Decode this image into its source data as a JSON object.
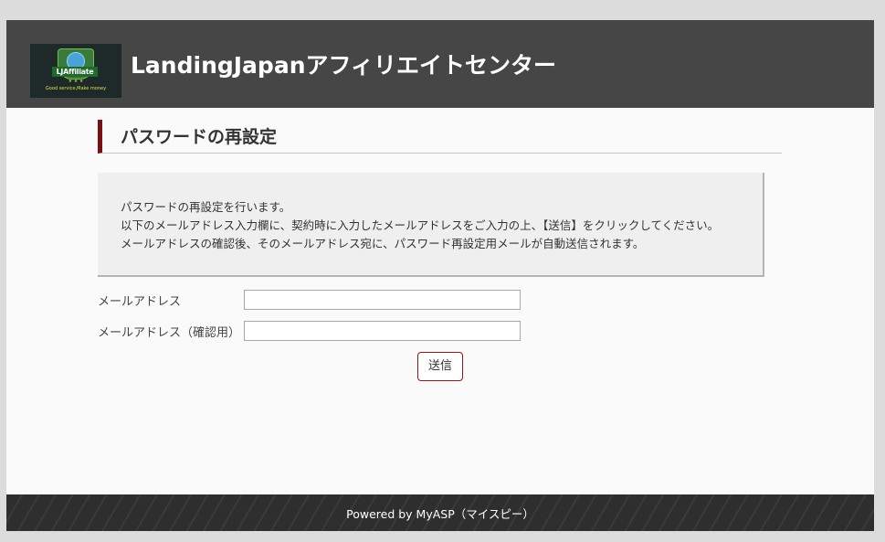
{
  "header": {
    "logo": {
      "brand": "LJAffiliate",
      "stars": "★ ★ ★",
      "tagline": "Good service,Make money"
    },
    "title": "LandingJapanアフィリエイトセンター"
  },
  "main": {
    "page_title": "パスワードの再設定",
    "info_lines": [
      "パスワードの再設定を行います。",
      "以下のメールアドレス入力欄に、契約時に入力したメールアドレスをご入力の上、【送信】をクリックしてください。",
      "メールアドレスの確認後、そのメールアドレス宛に、パスワード再設定用メールが自動送信されます。"
    ],
    "form": {
      "email_label": "メールアドレス",
      "email_value": "",
      "email_confirm_label": "メールアドレス（確認用）",
      "email_confirm_value": "",
      "submit_label": "送信"
    }
  },
  "footer": {
    "text": "Powered by MyASP（マイスピー）"
  },
  "colors": {
    "header_bg": "#464646",
    "accent": "#7a0f12",
    "footer_bg": "#2e2e2e"
  }
}
